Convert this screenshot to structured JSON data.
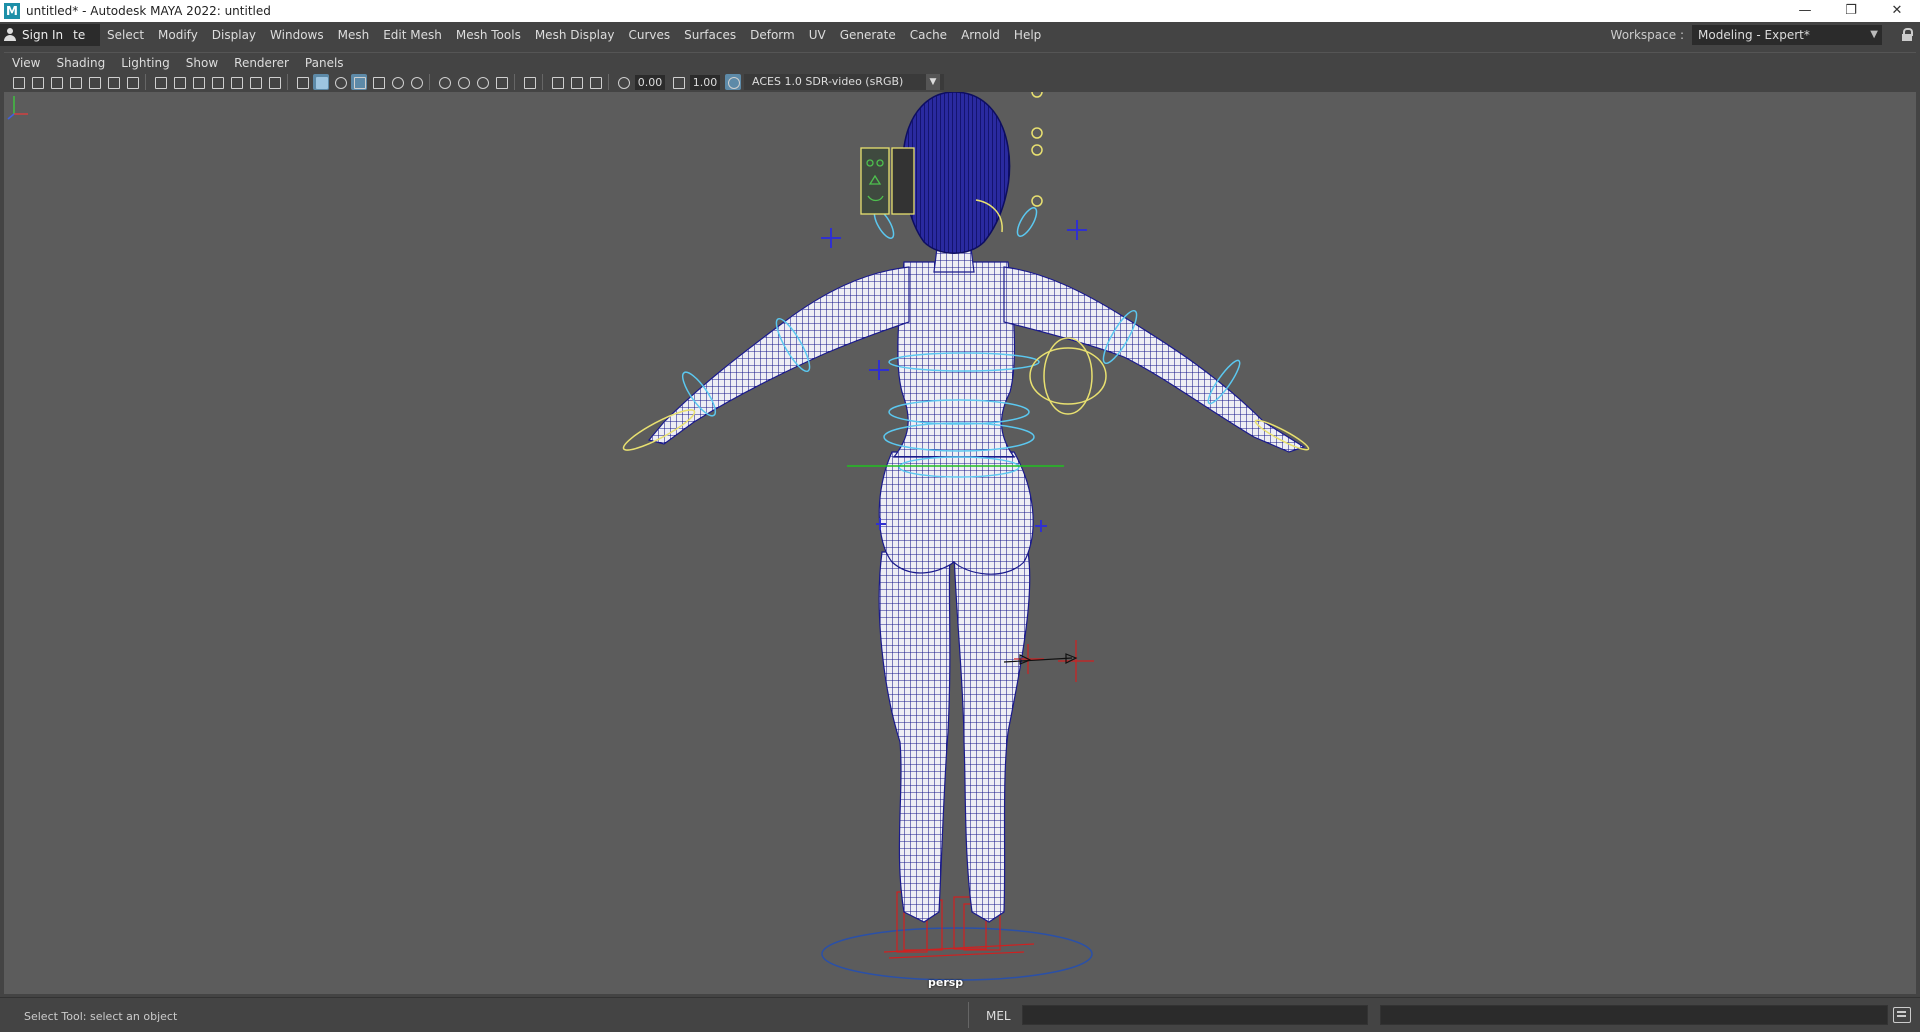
{
  "window": {
    "title": "untitled* - Autodesk MAYA 2022: untitled",
    "app_icon": "M",
    "controls": [
      "minimize-icon",
      "restore-icon",
      "close-icon"
    ]
  },
  "menubar": {
    "sign_in": "Sign In",
    "partial_menu": "te",
    "menus": [
      "Select",
      "Modify",
      "Display",
      "Windows",
      "Mesh",
      "Edit Mesh",
      "Mesh Tools",
      "Mesh Display",
      "Curves",
      "Surfaces",
      "Deform",
      "UV",
      "Generate",
      "Cache",
      "Arnold",
      "Help"
    ],
    "workspace_label": "Workspace :",
    "workspace_value": "Modeling - Expert*"
  },
  "panel": {
    "menus": [
      "View",
      "Shading",
      "Lighting",
      "Show",
      "Renderer",
      "Panels"
    ],
    "toolbar": {
      "exposure": "0.00",
      "gamma": "1.00",
      "color_space": "ACES 1.0 SDR-video (sRGB)"
    },
    "camera_label": "persp"
  },
  "colors": {
    "viewport_bg": "#5c5c5c",
    "wireframe": "#1a1a8c",
    "control_cyan": "#5bc8f0",
    "control_yellow": "#e8e070",
    "ik_red": "#d02020",
    "ground_ring": "#2a50a8"
  },
  "statusbar": {
    "help_line": "Select Tool: select an object",
    "command_label": "MEL"
  }
}
